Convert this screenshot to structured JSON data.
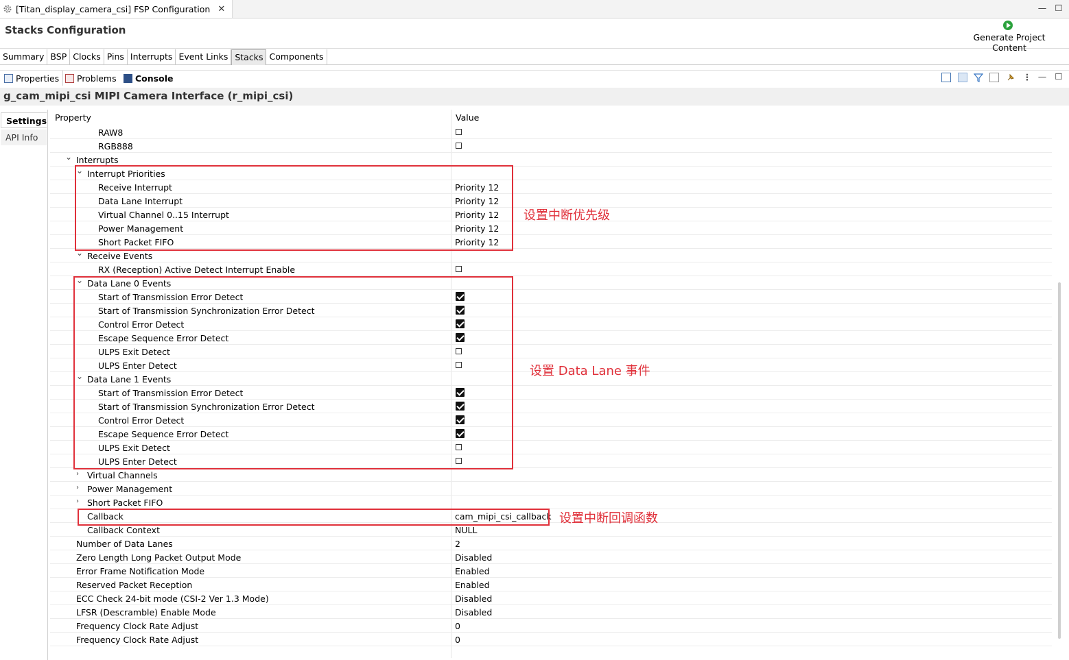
{
  "window": {
    "tab_title": "[Titan_display_camera_csi] FSP Configuration",
    "close_glyph": "✕",
    "minimize_glyph": "—",
    "maximize_glyph": "☐"
  },
  "header": {
    "title": "Stacks Configuration",
    "generate_label": "Generate Project Content"
  },
  "config_tabs": [
    "Summary",
    "BSP",
    "Clocks",
    "Pins",
    "Interrupts",
    "Event Links",
    "Stacks",
    "Components"
  ],
  "config_tab_active": "Stacks",
  "view_tabs": {
    "properties": "Properties",
    "problems": "Problems",
    "console": "Console"
  },
  "component_title": "g_cam_mipi_csi MIPI Camera Interface (r_mipi_csi)",
  "side_tabs": {
    "settings": "Settings",
    "api_info": "API Info"
  },
  "table": {
    "col_property": "Property",
    "col_value": "Value",
    "rows": [
      {
        "label": "RAW8",
        "indent": 2,
        "type": "checkbox",
        "checked": false
      },
      {
        "label": "RGB888",
        "indent": 2,
        "type": "checkbox",
        "checked": false
      },
      {
        "label": "Interrupts",
        "indent": 0,
        "type": "group",
        "expanded": true
      },
      {
        "label": "Interrupt Priorities",
        "indent": 1,
        "type": "group",
        "expanded": true
      },
      {
        "label": "Receive Interrupt",
        "indent": 2,
        "type": "text",
        "value": "Priority 12"
      },
      {
        "label": "Data Lane Interrupt",
        "indent": 2,
        "type": "text",
        "value": "Priority 12"
      },
      {
        "label": "Virtual Channel 0..15 Interrupt",
        "indent": 2,
        "type": "text",
        "value": "Priority 12"
      },
      {
        "label": "Power Management",
        "indent": 2,
        "type": "text",
        "value": "Priority 12"
      },
      {
        "label": "Short Packet FIFO",
        "indent": 2,
        "type": "text",
        "value": "Priority 12"
      },
      {
        "label": "Receive Events",
        "indent": 1,
        "type": "group",
        "expanded": true
      },
      {
        "label": "RX (Reception) Active Detect Interrupt Enable",
        "indent": 2,
        "type": "checkbox",
        "checked": false
      },
      {
        "label": "Data Lane 0 Events",
        "indent": 1,
        "type": "group",
        "expanded": true
      },
      {
        "label": "Start of Transmission Error Detect",
        "indent": 2,
        "type": "checkbox",
        "checked": true
      },
      {
        "label": "Start of Transmission Synchronization Error Detect",
        "indent": 2,
        "type": "checkbox",
        "checked": true
      },
      {
        "label": "Control Error Detect",
        "indent": 2,
        "type": "checkbox",
        "checked": true
      },
      {
        "label": "Escape Sequence Error Detect",
        "indent": 2,
        "type": "checkbox",
        "checked": true
      },
      {
        "label": "ULPS Exit Detect",
        "indent": 2,
        "type": "checkbox",
        "checked": false
      },
      {
        "label": "ULPS Enter Detect",
        "indent": 2,
        "type": "checkbox",
        "checked": false
      },
      {
        "label": "Data Lane 1 Events",
        "indent": 1,
        "type": "group",
        "expanded": true
      },
      {
        "label": "Start of Transmission Error Detect",
        "indent": 2,
        "type": "checkbox",
        "checked": true
      },
      {
        "label": "Start of Transmission Synchronization Error Detect",
        "indent": 2,
        "type": "checkbox",
        "checked": true
      },
      {
        "label": "Control Error Detect",
        "indent": 2,
        "type": "checkbox",
        "checked": true
      },
      {
        "label": "Escape Sequence Error Detect",
        "indent": 2,
        "type": "checkbox",
        "checked": true
      },
      {
        "label": "ULPS Exit Detect",
        "indent": 2,
        "type": "checkbox",
        "checked": false
      },
      {
        "label": "ULPS Enter Detect",
        "indent": 2,
        "type": "checkbox",
        "checked": false
      },
      {
        "label": "Virtual Channels",
        "indent": 1,
        "type": "group",
        "expanded": false
      },
      {
        "label": "Power Management",
        "indent": 1,
        "type": "group",
        "expanded": false
      },
      {
        "label": "Short Packet FIFO",
        "indent": 1,
        "type": "group",
        "expanded": false
      },
      {
        "label": "Callback",
        "indent": 1,
        "type": "text",
        "value": "cam_mipi_csi_callback"
      },
      {
        "label": "Callback Context",
        "indent": 1,
        "type": "text",
        "value": "NULL"
      },
      {
        "label": "Number of Data Lanes",
        "indent": 0,
        "type": "text",
        "value": "2"
      },
      {
        "label": "Zero Length Long Packet Output Mode",
        "indent": 0,
        "type": "text",
        "value": "Disabled"
      },
      {
        "label": "Error Frame Notification Mode",
        "indent": 0,
        "type": "text",
        "value": "Enabled"
      },
      {
        "label": "Reserved Packet Reception",
        "indent": 0,
        "type": "text",
        "value": "Enabled"
      },
      {
        "label": "ECC Check 24-bit mode (CSI-2 Ver 1.3 Mode)",
        "indent": 0,
        "type": "text",
        "value": "Disabled"
      },
      {
        "label": "LFSR (Descramble) Enable Mode",
        "indent": 0,
        "type": "text",
        "value": "Disabled"
      },
      {
        "label": "Frequency Clock Rate Adjust",
        "indent": 0,
        "type": "text",
        "value": "0"
      },
      {
        "label": "Frequency Clock Rate Adjust",
        "indent": 0,
        "type": "text",
        "value": "0"
      }
    ]
  },
  "annotations": {
    "priority": "设置中断优先级",
    "data_lane": "设置 Data Lane 事件",
    "callback": "设置中断回调函数"
  },
  "colors": {
    "annotation": "#e0303a",
    "accent_green": "#2aa13c"
  }
}
